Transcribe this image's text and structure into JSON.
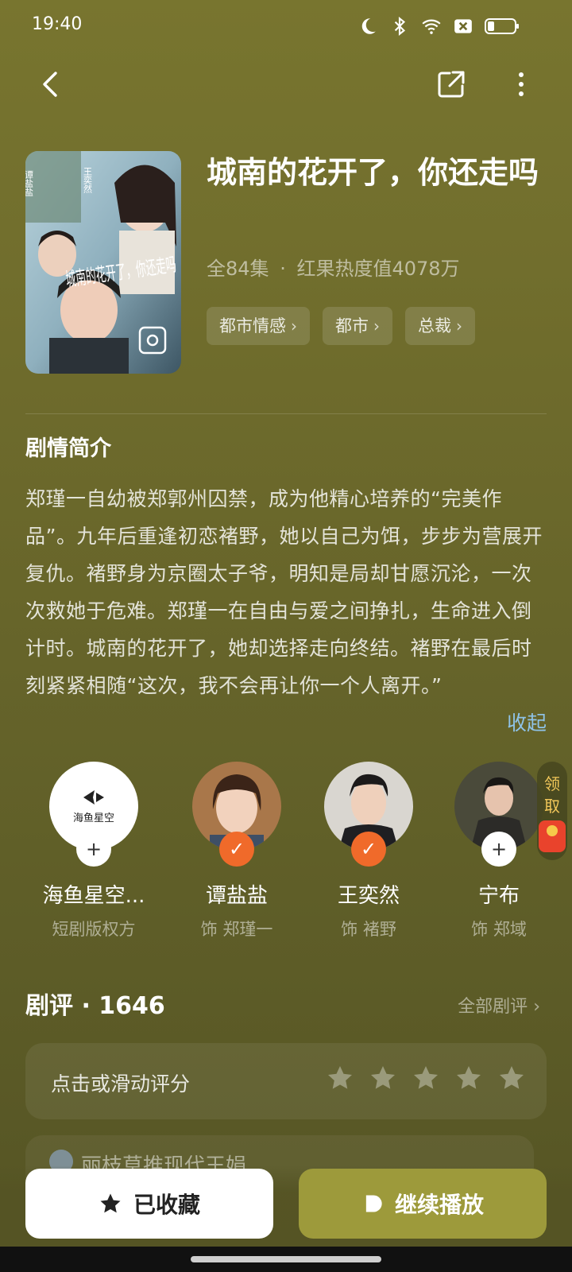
{
  "status_bar": {
    "time": "19:40",
    "icons": [
      "moon-icon",
      "bluetooth-icon",
      "wifi-icon",
      "sim-x-icon",
      "battery-icon"
    ]
  },
  "nav": {
    "back_icon": "chevron-left-icon",
    "share_icon": "share-icon",
    "more_icon": "more-vertical-icon"
  },
  "drama": {
    "title": "城南的花开了，你还走吗",
    "episodes": "全84集",
    "separator": "·",
    "heat": "红果热度值4078万",
    "tags": [
      {
        "label": "都市情感"
      },
      {
        "label": "都市"
      },
      {
        "label": "总裁"
      }
    ],
    "poster": {
      "overlay_text": "城南的花开了，你还走吗",
      "cast_labels": [
        "谭盐盐",
        "王奕然"
      ]
    }
  },
  "synopsis": {
    "heading": "剧情简介",
    "text": "郑瑾一自幼被郑郭州囚禁，成为他精心培养的“完美作品”。九年后重逢初恋褚野，她以自己为饵，步步为营展开复仇。褚野身为京圈太子爷，明知是局却甘愿沉沦，一次次救她于危难。郑瑾一在自由与爱之间挣扎，生命进入倒计时。城南的花开了，她却选择走向终结。褚野在最后时刻紧紧相随“这次，我不会再让你一个人离开。”",
    "collapse_label": "收起"
  },
  "cast": [
    {
      "name": "海鱼星空...",
      "role": "短剧版权方",
      "badge": "plus",
      "logo_text": "海鱼星空"
    },
    {
      "name": "谭盐盐",
      "role": "饰 郑瑾一",
      "badge": "check"
    },
    {
      "name": "王奕然",
      "role": "饰 褚野",
      "badge": "check"
    },
    {
      "name": "宁布",
      "role": "饰 郑域",
      "badge": "plus"
    }
  ],
  "reward": {
    "line1": "领",
    "line2": "取"
  },
  "reviews": {
    "heading": "剧评 · 1646",
    "all_label": "全部剧评",
    "rate_prompt": "点击或滑动评分",
    "star_count": 5,
    "preview_user": "丽枝草推现代王娟"
  },
  "bottom": {
    "favorite_label": "已收藏",
    "play_label": "继续播放"
  },
  "colors": {
    "background": "#6e6b2c",
    "accent_play": "#9d9a3b",
    "check_badge": "#f06a2a",
    "link": "#8fc3e8"
  }
}
